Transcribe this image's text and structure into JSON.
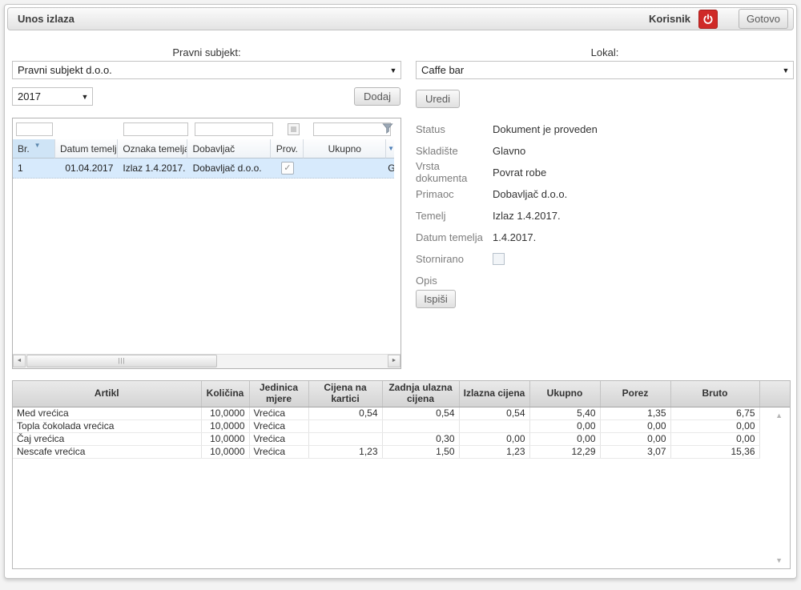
{
  "titlebar": {
    "title": "Unos izlaza",
    "user_label": "Korisnik",
    "done_button": "Gotovo"
  },
  "selectors": {
    "legal_entity_label": "Pravni subjekt:",
    "legal_entity_value": "Pravni subjekt d.o.o.",
    "location_label": "Lokal:",
    "location_value": "Caffe bar",
    "year_value": "2017",
    "add_button": "Dodaj",
    "edit_button": "Uredi"
  },
  "documents_grid": {
    "columns": [
      "Br.",
      "Datum temelja",
      "Oznaka temelja",
      "Dobavljač",
      "Prov.",
      "Ukupno"
    ],
    "row": {
      "br": "1",
      "datum_temelja": "01.04.2017",
      "oznaka_temelja": "Izlaz 1.4.2017.",
      "dobavljac": "Dobavljač d.o.o.",
      "prov_checked": true,
      "ukupno": "",
      "next_column_partial": "Gla"
    }
  },
  "details": {
    "fields": [
      {
        "label": "Status",
        "value": "Dokument je proveden"
      },
      {
        "label": "Skladište",
        "value": "Glavno"
      },
      {
        "label": "Vrsta dokumenta",
        "value": "Povrat robe"
      },
      {
        "label": "Primaoc",
        "value": "Dobavljač d.o.o."
      },
      {
        "label": "Temelj",
        "value": "Izlaz 1.4.2017."
      },
      {
        "label": "Datum temelja",
        "value": "1.4.2017."
      },
      {
        "label": "Stornirano",
        "value": ""
      },
      {
        "label": "Opis",
        "value": ""
      }
    ],
    "stornirano_checked": false,
    "print_button": "Ispiši"
  },
  "items_table": {
    "columns": [
      "Artikl",
      "Količina",
      "Jedinica mjere",
      "Cijena na kartici",
      "Zadnja ulazna cijena",
      "Izlazna cijena",
      "Ukupno",
      "Porez",
      "Bruto"
    ],
    "rows": [
      {
        "artikl": "Med vrećica",
        "kolicina": "10,0000",
        "jedinica": "Vrećica",
        "cijena_na_kartici": "0,54",
        "zadnja_ulazna": "0,54",
        "izlazna": "0,54",
        "ukupno": "5,40",
        "porez": "1,35",
        "bruto": "6,75"
      },
      {
        "artikl": "Topla čokolada vrećica",
        "kolicina": "10,0000",
        "jedinica": "Vrećica",
        "cijena_na_kartici": "",
        "zadnja_ulazna": "",
        "izlazna": "",
        "ukupno": "0,00",
        "porez": "0,00",
        "bruto": "0,00"
      },
      {
        "artikl": "Čaj vrećica",
        "kolicina": "10,0000",
        "jedinica": "Vrećica",
        "cijena_na_kartici": "",
        "zadnja_ulazna": "0,30",
        "izlazna": "0,00",
        "ukupno": "0,00",
        "porez": "0,00",
        "bruto": "0,00"
      },
      {
        "artikl": "Nescafe vrećica",
        "kolicina": "10,0000",
        "jedinica": "Vrećica",
        "cijena_na_kartici": "1,23",
        "zadnja_ulazna": "1,50",
        "izlazna": "1,23",
        "ukupno": "12,29",
        "porez": "3,07",
        "bruto": "15,36"
      }
    ]
  },
  "icons": {
    "checkmark": "✓",
    "sort_desc": "▼",
    "dropdown_arrow": "▼",
    "scroll_left": "◄",
    "scroll_right": "►",
    "scroll_up": "▲",
    "scroll_down": "▼",
    "thumb_grip": "|||"
  },
  "colors": {
    "selected_row": "#d7eafc",
    "sorted_header": "#cfe4f6",
    "power_button": "#cf2a27",
    "titlebar_gradient_top": "#fbfbfb",
    "titlebar_gradient_bottom": "#e3e3e3"
  }
}
